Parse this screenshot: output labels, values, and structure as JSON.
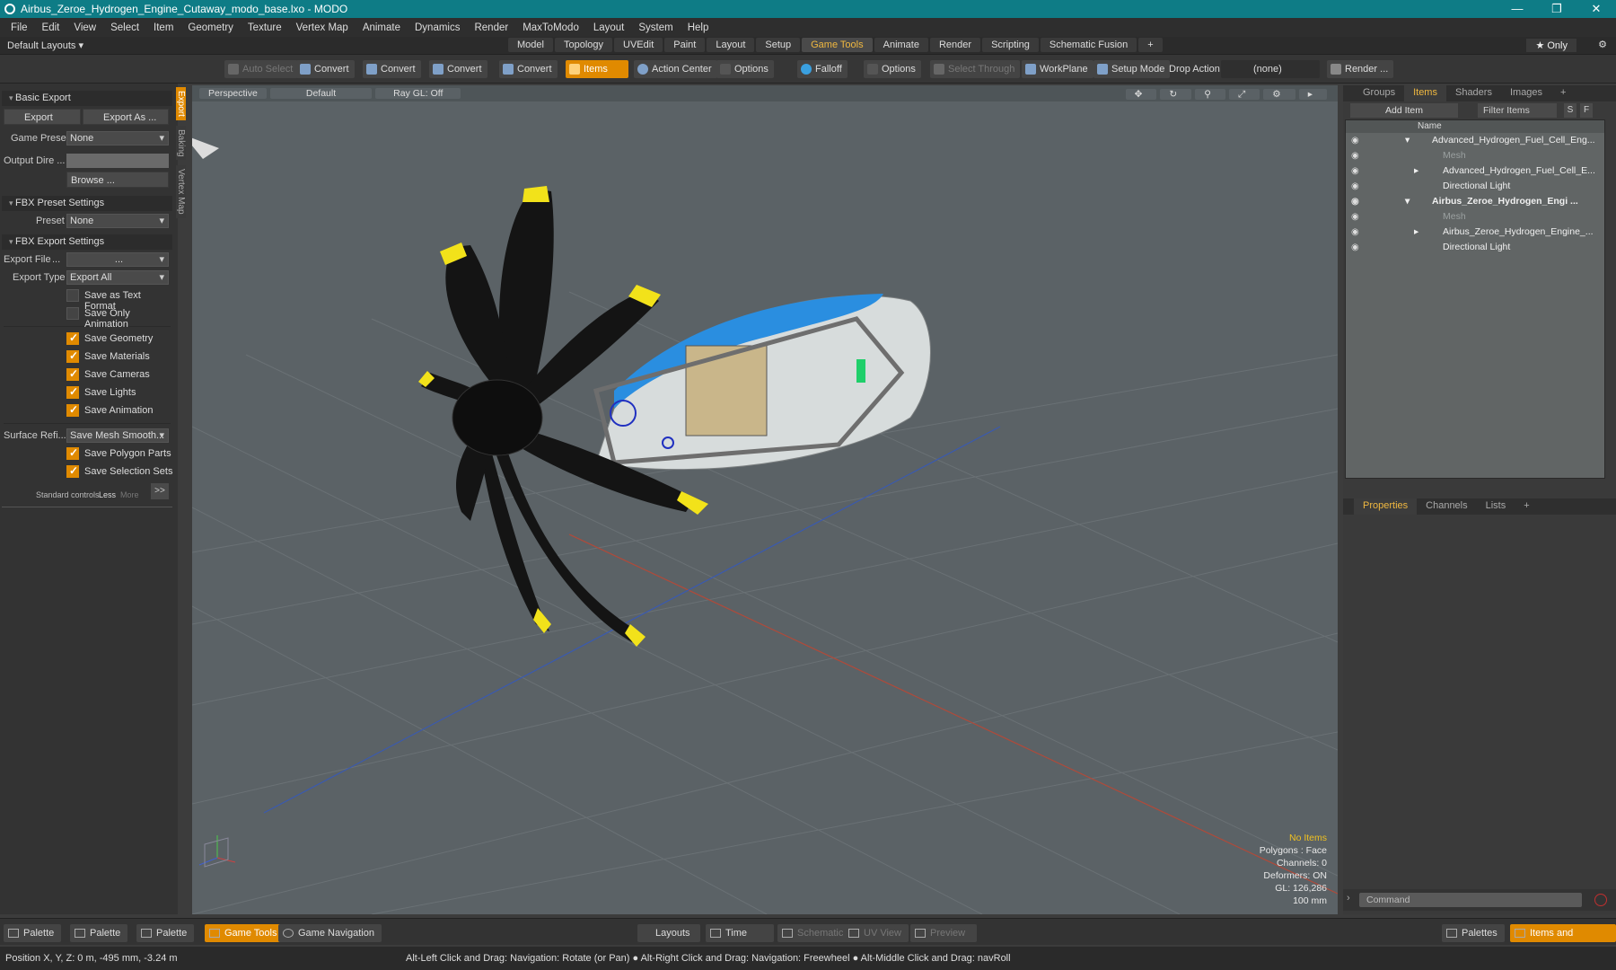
{
  "window": {
    "title": "Airbus_Zeroe_Hydrogen_Engine_Cutaway_modo_base.lxo - MODO",
    "controls": [
      "—",
      "❐",
      "✕"
    ]
  },
  "menu": [
    "File",
    "Edit",
    "View",
    "Select",
    "Item",
    "Geometry",
    "Texture",
    "Vertex Map",
    "Animate",
    "Dynamics",
    "Render",
    "MaxToModo",
    "Layout",
    "System",
    "Help"
  ],
  "layoutbar": {
    "default_layouts": "Default Layouts ▾",
    "tabs": [
      "Model",
      "Topology",
      "UVEdit",
      "Paint",
      "Layout",
      "Setup",
      "Game Tools",
      "Animate",
      "Render",
      "Scripting",
      "Schematic Fusion",
      "+"
    ],
    "active_tab": "Game Tools",
    "only": "★  Only"
  },
  "toolbar": {
    "auto_select": "Auto Select",
    "convert": "Convert",
    "items": "Items",
    "action_center": "Action Center",
    "options": "Options",
    "falloff": "Falloff",
    "select_through": "Select Through",
    "workplane": "WorkPlane",
    "setup_mode": "Setup Mode",
    "drop_action": "Drop Action",
    "drop_value": "(none)",
    "render": "Render ..."
  },
  "left": {
    "side_tabs": [
      "Export",
      "Baking",
      "Vertex Map"
    ],
    "basic_export": "Basic Export",
    "export_btn": "Export",
    "export_as_btn": "Export As ...",
    "game_preset_label": "Game Preset",
    "game_preset_value": "None",
    "output_dir_label": "Output Dire ...",
    "browse": "Browse ...",
    "fbx_preset_settings": "FBX Preset Settings",
    "preset_label": "Preset",
    "preset_value": "None",
    "fbx_export_settings": "FBX Export Settings",
    "export_file_label": "Export File",
    "export_file_dots": "...",
    "export_file_value": "...",
    "export_type_label": "Export Type",
    "export_type_value": "Export All",
    "save_text_format": "Save as Text Format",
    "save_only_animation": "Save Only Animation",
    "save_geometry": "Save Geometry",
    "save_materials": "Save Materials",
    "save_cameras": "Save Cameras",
    "save_lights": "Save Lights",
    "save_animation": "Save Animation",
    "surface_ref_label": "Surface Refi...",
    "surface_ref_value": "Save Mesh Smooth...",
    "save_polygon_parts": "Save Polygon Parts",
    "save_selection_sets": "Save Selection Sets",
    "standard_controls": "Standard controls",
    "less": "Less",
    "more": "More",
    "expand": ">>"
  },
  "viewport": {
    "view": "Perspective",
    "shading": "Default",
    "raygl": "Ray GL: Off",
    "info": {
      "selection": "No Items",
      "polygons": "Polygons : Face",
      "channels": "Channels: 0",
      "deformers": "Deformers: ON",
      "gl": "GL: 126,286",
      "scale": "100 mm"
    },
    "colors": {
      "prop": "#141414",
      "tip": "#f2e21a",
      "cowl": "#2a8ee0",
      "grid": "#676e72"
    }
  },
  "right": {
    "top_tabs": [
      "Groups",
      "Items",
      "Shaders",
      "Images",
      "+"
    ],
    "active_top": "Items",
    "add_item": "Add Item",
    "filter_items": "Filter Items",
    "s": "S",
    "f": "F",
    "name_header": "Name",
    "items": [
      {
        "label": "Advanced_Hydrogen_Fuel_Cell_Eng...",
        "indent": 0,
        "style": "normal",
        "arrow": "▾"
      },
      {
        "label": "Mesh",
        "indent": 1,
        "style": "dim",
        "arrow": ""
      },
      {
        "label": "Advanced_Hydrogen_Fuel_Cell_E...",
        "indent": 1,
        "style": "normal",
        "arrow": "▸"
      },
      {
        "label": "Directional Light",
        "indent": 1,
        "style": "normal",
        "arrow": ""
      },
      {
        "label": "Airbus_Zeroe_Hydrogen_Engi ...",
        "indent": 0,
        "style": "bold",
        "arrow": "▾"
      },
      {
        "label": "Mesh",
        "indent": 1,
        "style": "dim",
        "arrow": ""
      },
      {
        "label": "Airbus_Zeroe_Hydrogen_Engine_...",
        "indent": 1,
        "style": "normal",
        "arrow": "▸"
      },
      {
        "label": "Directional Light",
        "indent": 1,
        "style": "normal",
        "arrow": ""
      }
    ],
    "bottom_tabs": [
      "Properties",
      "Channels",
      "Lists",
      "+"
    ],
    "active_bottom": "Properties",
    "command_placeholder": "Command"
  },
  "bottombar": {
    "palette": "Palette",
    "game_tools": "Game Tools",
    "game_navigation": "Game Navigation",
    "layouts": "Layouts",
    "time": "Time",
    "schematic": "Schematic",
    "uv_view": "UV View",
    "preview": "Preview",
    "palettes": "Palettes",
    "items_and_shading": "Items and Shading"
  },
  "status": {
    "position": "Position X, Y, Z:  0 m, -495 mm, -3.24 m",
    "hint": "Alt-Left Click and Drag: Navigation: Rotate (or Pan) ● Alt-Right Click and Drag: Navigation: Freewheel ● Alt-Middle Click and Drag: navRoll"
  }
}
